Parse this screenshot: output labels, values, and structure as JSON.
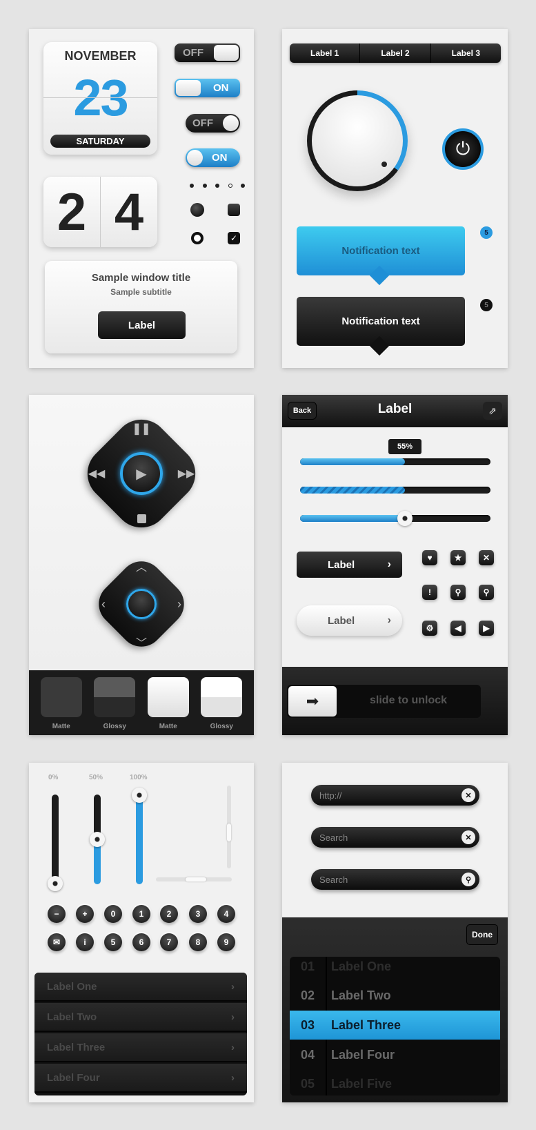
{
  "colors": {
    "accent": "#2b9be0",
    "dark": "#1a1a1a",
    "panel": "#f1f1f1"
  },
  "calendar": {
    "month": "NOVEMBER",
    "day": "23",
    "weekday": "SATURDAY"
  },
  "flip_clock": {
    "digit1": "2",
    "digit2": "4"
  },
  "toggles": [
    {
      "label": "OFF",
      "state": false
    },
    {
      "label": "ON",
      "state": true
    },
    {
      "label": "OFF",
      "state": false
    },
    {
      "label": "ON",
      "state": true
    }
  ],
  "page_dots": {
    "count": 5,
    "active": 3
  },
  "window": {
    "title": "Sample window title",
    "subtitle": "Sample subtitle",
    "button": "Label"
  },
  "segmented": {
    "items": [
      "Label 1",
      "Label 2",
      "Label 3"
    ]
  },
  "knob": {
    "value_fraction": 0.35
  },
  "notifications": [
    {
      "text": "Notification text",
      "badge": "5",
      "style": "blue"
    },
    {
      "text": "Notification text",
      "badge": "5",
      "style": "dark"
    }
  ],
  "media": {
    "pause_icon": "pause-icon",
    "play_icon": "play-icon",
    "rewind_icon": "rewind-icon",
    "forward_icon": "fast-forward-icon",
    "stop_icon": "stop-icon"
  },
  "tiles": [
    "Matte",
    "Glossy",
    "Matte",
    "Glossy"
  ],
  "navbar": {
    "back": "Back",
    "title": "Label",
    "share_icon": "share-icon"
  },
  "sliders": {
    "tooltip": "55%",
    "value_percent": 55
  },
  "buttons": {
    "dark": "Label",
    "light": "Label"
  },
  "icon_grid": [
    "heart-icon",
    "star-icon",
    "close-icon",
    "alert-icon",
    "search-icon",
    "location-icon",
    "gear-icon",
    "arrow-left-icon",
    "arrow-right-icon"
  ],
  "unlock": {
    "text": "slide to unlock"
  },
  "vsliders": {
    "labels": [
      "0%",
      "50%",
      "100%"
    ],
    "values": [
      0,
      50,
      100
    ]
  },
  "round_buttons": {
    "row1": [
      "−",
      "+",
      "0",
      "1",
      "2",
      "3",
      "4"
    ],
    "row2": [
      "✉",
      "i",
      "5",
      "6",
      "7",
      "8",
      "9"
    ]
  },
  "list": {
    "items": [
      "Label One",
      "Label Two",
      "Label Three",
      "Label Four"
    ]
  },
  "inputs": [
    {
      "value": "",
      "placeholder": "http://"
    },
    {
      "value": "",
      "placeholder": "Search"
    },
    {
      "value": "",
      "placeholder": "Search"
    }
  ],
  "picker": {
    "done": "Done",
    "rows": [
      {
        "num": "01",
        "label": "Label One"
      },
      {
        "num": "02",
        "label": "Label Two"
      },
      {
        "num": "03",
        "label": "Label Three"
      },
      {
        "num": "04",
        "label": "Label Four"
      },
      {
        "num": "05",
        "label": "Label Five"
      }
    ],
    "selected": 2
  }
}
